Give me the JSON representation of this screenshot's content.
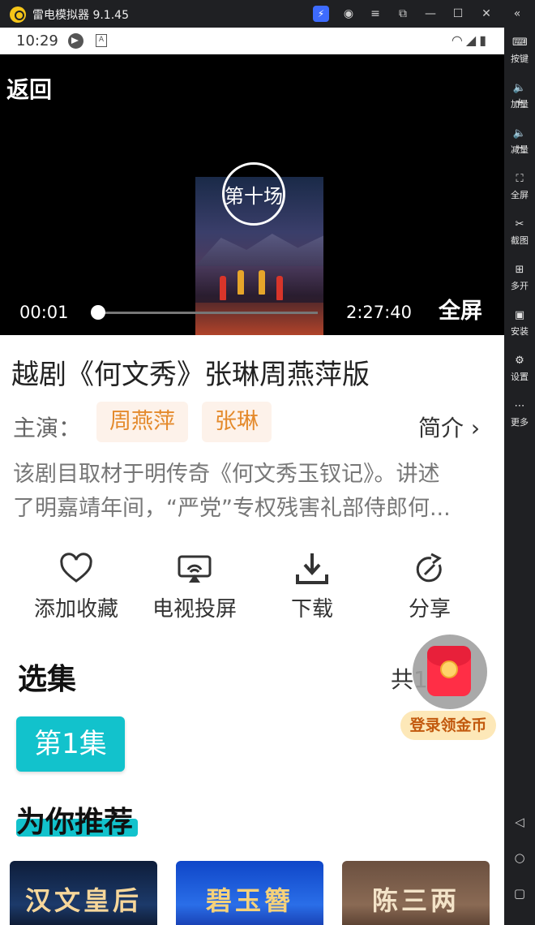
{
  "window": {
    "title": "雷电模拟器 9.1.45"
  },
  "status_bar": {
    "time": "10:29",
    "badge_a": "A"
  },
  "sidebar": {
    "items": [
      {
        "label": "按键",
        "icon": "keyboard-icon"
      },
      {
        "label": "加量",
        "icon": "volume-up-icon"
      },
      {
        "label": "减量",
        "icon": "volume-down-icon"
      },
      {
        "label": "全屏",
        "icon": "fullscreen-icon"
      },
      {
        "label": "截图",
        "icon": "scissors-icon"
      },
      {
        "label": "多开",
        "icon": "multi-open-icon"
      },
      {
        "label": "安装",
        "icon": "apk-icon"
      },
      {
        "label": "设置",
        "icon": "gear-icon"
      },
      {
        "label": "更多",
        "icon": "more-icon"
      }
    ]
  },
  "player": {
    "back_label": "返回",
    "watermark": "第十场",
    "current_time": "00:01",
    "total_time": "2:27:40",
    "progress": 0.0001,
    "fullscreen_label": "全屏"
  },
  "show": {
    "title": "越剧《何文秀》张琳周燕萍版",
    "cast_label": "主演：",
    "cast": [
      "周燕萍",
      "张琳"
    ],
    "intro_label": "简介",
    "description_lines": [
      "该剧目取材于明传奇《何文秀玉钗记》。讲述",
      "了明嘉靖年间，“严党”专权残害礼部侍郎何..."
    ]
  },
  "actions": [
    {
      "label": "添加收藏",
      "icon": "heart-icon"
    },
    {
      "label": "电视投屏",
      "icon": "cast-tv-icon"
    },
    {
      "label": "下载",
      "icon": "download-icon"
    },
    {
      "label": "分享",
      "icon": "share-icon"
    }
  ],
  "episodes": {
    "title": "选集",
    "count_label": "共1",
    "items": [
      "第1集"
    ]
  },
  "recommend": {
    "title": "为你推荐",
    "cards": [
      "汉文皇后",
      "碧玉簪",
      "陈三两"
    ]
  },
  "floating": {
    "label": "登录领金币"
  },
  "colors": {
    "accent": "#12c2cc",
    "chip_bg": "#fdf2ea",
    "chip_text": "#e48a2c",
    "promo_bg": "#fde8b8",
    "promo_text": "#c2590e"
  }
}
